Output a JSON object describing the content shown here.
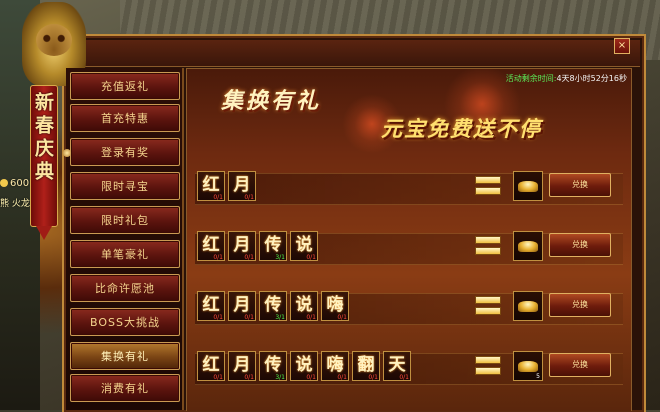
{
  "event": {
    "banner": "新春庆典",
    "gold_amount": "600",
    "player_name": "熊 火龙"
  },
  "window": {
    "close_label": "×"
  },
  "sidebar": {
    "items": [
      {
        "label": "充值返礼"
      },
      {
        "label": "首充特惠"
      },
      {
        "label": "登录有奖"
      },
      {
        "label": "限时寻宝"
      },
      {
        "label": "限时礼包"
      },
      {
        "label": "单笔豪礼"
      },
      {
        "label": "比命许愿池"
      },
      {
        "label": "BOSS大挑战"
      },
      {
        "label": "集换有礼"
      },
      {
        "label": "消费有礼"
      }
    ],
    "active_index": 8
  },
  "content": {
    "title": "集换有礼",
    "subtitle": "元宝免费送不停",
    "timer_label": "活动剩余时间:",
    "timer_value": "4天8小时52分16秒",
    "exchange_label": "兑换",
    "rows": [
      {
        "glyphs": [
          {
            "char": "红",
            "count": "0/1",
            "ok": false
          },
          {
            "char": "月",
            "count": "0/1",
            "ok": false
          }
        ],
        "reward_qty": ""
      },
      {
        "glyphs": [
          {
            "char": "红",
            "count": "0/1",
            "ok": false
          },
          {
            "char": "月",
            "count": "0/1",
            "ok": false
          },
          {
            "char": "传",
            "count": "3/1",
            "ok": true
          },
          {
            "char": "说",
            "count": "0/1",
            "ok": false
          }
        ],
        "reward_qty": ""
      },
      {
        "glyphs": [
          {
            "char": "红",
            "count": "0/1",
            "ok": false
          },
          {
            "char": "月",
            "count": "0/1",
            "ok": false
          },
          {
            "char": "传",
            "count": "3/1",
            "ok": true
          },
          {
            "char": "说",
            "count": "0/1",
            "ok": false
          },
          {
            "char": "嗨",
            "count": "0/1",
            "ok": false
          }
        ],
        "reward_qty": ""
      },
      {
        "glyphs": [
          {
            "char": "红",
            "count": "0/1",
            "ok": false
          },
          {
            "char": "月",
            "count": "0/1",
            "ok": false
          },
          {
            "char": "传",
            "count": "3/1",
            "ok": true
          },
          {
            "char": "说",
            "count": "0/1",
            "ok": false
          },
          {
            "char": "嗨",
            "count": "0/1",
            "ok": false
          },
          {
            "char": "翻",
            "count": "0/1",
            "ok": false
          },
          {
            "char": "天",
            "count": "0/1",
            "ok": false
          }
        ],
        "reward_qty": "5"
      }
    ]
  }
}
